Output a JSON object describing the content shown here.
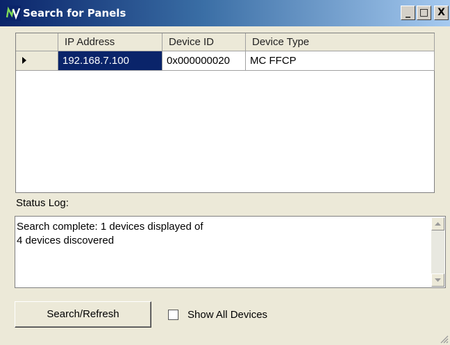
{
  "window": {
    "title": "Search for Panels",
    "icon": "nv-logo-icon",
    "controls": {
      "minimize": "_",
      "maximize": "□",
      "close": "X"
    }
  },
  "grid": {
    "columns": [
      "IP Address",
      "Device ID",
      "Device Type"
    ],
    "rows": [
      {
        "selected": true,
        "ip": "192.168.7.100",
        "device_id": "0x000000020",
        "device_type": "MC FFCP"
      }
    ]
  },
  "status": {
    "label": "Status Log:",
    "lines": [
      "Search complete: 1 devices displayed of",
      "4 devices discovered"
    ]
  },
  "actions": {
    "search_label": "Search/Refresh",
    "show_all_label": "Show All Devices",
    "show_all_checked": false
  },
  "colors": {
    "selection": "#0a246a",
    "title_start": "#0a246a",
    "title_end": "#a6caf0"
  }
}
